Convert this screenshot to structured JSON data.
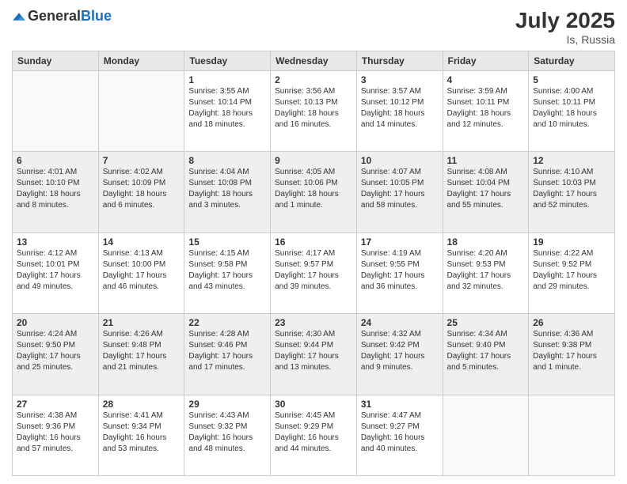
{
  "header": {
    "logo_general": "General",
    "logo_blue": "Blue",
    "month": "July 2025",
    "location": "Is, Russia"
  },
  "days_of_week": [
    "Sunday",
    "Monday",
    "Tuesday",
    "Wednesday",
    "Thursday",
    "Friday",
    "Saturday"
  ],
  "weeks": [
    [
      {
        "day": "",
        "info": ""
      },
      {
        "day": "",
        "info": ""
      },
      {
        "day": "1",
        "info": "Sunrise: 3:55 AM\nSunset: 10:14 PM\nDaylight: 18 hours and 18 minutes."
      },
      {
        "day": "2",
        "info": "Sunrise: 3:56 AM\nSunset: 10:13 PM\nDaylight: 18 hours and 16 minutes."
      },
      {
        "day": "3",
        "info": "Sunrise: 3:57 AM\nSunset: 10:12 PM\nDaylight: 18 hours and 14 minutes."
      },
      {
        "day": "4",
        "info": "Sunrise: 3:59 AM\nSunset: 10:11 PM\nDaylight: 18 hours and 12 minutes."
      },
      {
        "day": "5",
        "info": "Sunrise: 4:00 AM\nSunset: 10:11 PM\nDaylight: 18 hours and 10 minutes."
      }
    ],
    [
      {
        "day": "6",
        "info": "Sunrise: 4:01 AM\nSunset: 10:10 PM\nDaylight: 18 hours and 8 minutes."
      },
      {
        "day": "7",
        "info": "Sunrise: 4:02 AM\nSunset: 10:09 PM\nDaylight: 18 hours and 6 minutes."
      },
      {
        "day": "8",
        "info": "Sunrise: 4:04 AM\nSunset: 10:08 PM\nDaylight: 18 hours and 3 minutes."
      },
      {
        "day": "9",
        "info": "Sunrise: 4:05 AM\nSunset: 10:06 PM\nDaylight: 18 hours and 1 minute."
      },
      {
        "day": "10",
        "info": "Sunrise: 4:07 AM\nSunset: 10:05 PM\nDaylight: 17 hours and 58 minutes."
      },
      {
        "day": "11",
        "info": "Sunrise: 4:08 AM\nSunset: 10:04 PM\nDaylight: 17 hours and 55 minutes."
      },
      {
        "day": "12",
        "info": "Sunrise: 4:10 AM\nSunset: 10:03 PM\nDaylight: 17 hours and 52 minutes."
      }
    ],
    [
      {
        "day": "13",
        "info": "Sunrise: 4:12 AM\nSunset: 10:01 PM\nDaylight: 17 hours and 49 minutes."
      },
      {
        "day": "14",
        "info": "Sunrise: 4:13 AM\nSunset: 10:00 PM\nDaylight: 17 hours and 46 minutes."
      },
      {
        "day": "15",
        "info": "Sunrise: 4:15 AM\nSunset: 9:58 PM\nDaylight: 17 hours and 43 minutes."
      },
      {
        "day": "16",
        "info": "Sunrise: 4:17 AM\nSunset: 9:57 PM\nDaylight: 17 hours and 39 minutes."
      },
      {
        "day": "17",
        "info": "Sunrise: 4:19 AM\nSunset: 9:55 PM\nDaylight: 17 hours and 36 minutes."
      },
      {
        "day": "18",
        "info": "Sunrise: 4:20 AM\nSunset: 9:53 PM\nDaylight: 17 hours and 32 minutes."
      },
      {
        "day": "19",
        "info": "Sunrise: 4:22 AM\nSunset: 9:52 PM\nDaylight: 17 hours and 29 minutes."
      }
    ],
    [
      {
        "day": "20",
        "info": "Sunrise: 4:24 AM\nSunset: 9:50 PM\nDaylight: 17 hours and 25 minutes."
      },
      {
        "day": "21",
        "info": "Sunrise: 4:26 AM\nSunset: 9:48 PM\nDaylight: 17 hours and 21 minutes."
      },
      {
        "day": "22",
        "info": "Sunrise: 4:28 AM\nSunset: 9:46 PM\nDaylight: 17 hours and 17 minutes."
      },
      {
        "day": "23",
        "info": "Sunrise: 4:30 AM\nSunset: 9:44 PM\nDaylight: 17 hours and 13 minutes."
      },
      {
        "day": "24",
        "info": "Sunrise: 4:32 AM\nSunset: 9:42 PM\nDaylight: 17 hours and 9 minutes."
      },
      {
        "day": "25",
        "info": "Sunrise: 4:34 AM\nSunset: 9:40 PM\nDaylight: 17 hours and 5 minutes."
      },
      {
        "day": "26",
        "info": "Sunrise: 4:36 AM\nSunset: 9:38 PM\nDaylight: 17 hours and 1 minute."
      }
    ],
    [
      {
        "day": "27",
        "info": "Sunrise: 4:38 AM\nSunset: 9:36 PM\nDaylight: 16 hours and 57 minutes."
      },
      {
        "day": "28",
        "info": "Sunrise: 4:41 AM\nSunset: 9:34 PM\nDaylight: 16 hours and 53 minutes."
      },
      {
        "day": "29",
        "info": "Sunrise: 4:43 AM\nSunset: 9:32 PM\nDaylight: 16 hours and 48 minutes."
      },
      {
        "day": "30",
        "info": "Sunrise: 4:45 AM\nSunset: 9:29 PM\nDaylight: 16 hours and 44 minutes."
      },
      {
        "day": "31",
        "info": "Sunrise: 4:47 AM\nSunset: 9:27 PM\nDaylight: 16 hours and 40 minutes."
      },
      {
        "day": "",
        "info": ""
      },
      {
        "day": "",
        "info": ""
      }
    ]
  ]
}
